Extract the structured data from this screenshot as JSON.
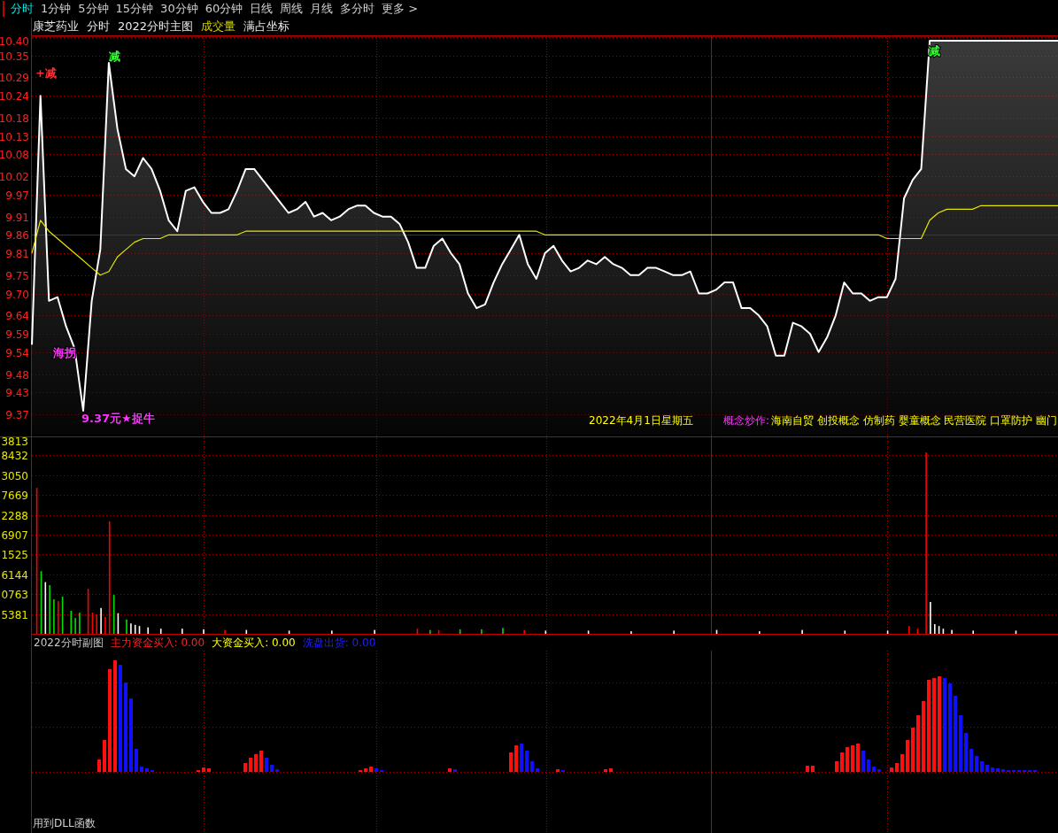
{
  "tabs": [
    {
      "label": "分时",
      "selected": true
    },
    {
      "label": "1分钟",
      "selected": false
    },
    {
      "label": "5分钟",
      "selected": false
    },
    {
      "label": "15分钟",
      "selected": false
    },
    {
      "label": "30分钟",
      "selected": false
    },
    {
      "label": "60分钟",
      "selected": false
    },
    {
      "label": "日线",
      "selected": false
    },
    {
      "label": "周线",
      "selected": false
    },
    {
      "label": "月线",
      "selected": false
    },
    {
      "label": "多分时",
      "selected": false
    },
    {
      "label": "更多 >",
      "selected": false
    }
  ],
  "header": {
    "items": [
      {
        "text": "康芝药业",
        "kind": "label"
      },
      {
        "text": "分时",
        "kind": "label"
      },
      {
        "text": "2022分时主图",
        "kind": "label"
      },
      {
        "text": "成交量",
        "kind": "study"
      },
      {
        "text": "满占坐标",
        "kind": "label"
      }
    ]
  },
  "price_chart": {
    "date": "2022年4月1日星期五",
    "concept_label": "概念炒作:",
    "concepts": "海南自贸 创投概念 仿制药 婴童概念 民营医院 口罩防护 幽门",
    "signals": [
      {
        "text": "+减",
        "color": "#ff3030"
      },
      {
        "text": "减",
        "color": "#33ff33"
      },
      {
        "text": "减",
        "color": "#33ff33"
      },
      {
        "text": "海拐",
        "color": "#ff33ff"
      },
      {
        "text": "9.37元★捉牛",
        "color": "#ff33ff"
      }
    ],
    "chart_data": {
      "type": "line",
      "ylim": [
        9.37,
        10.4
      ],
      "grid": true,
      "yticks": [
        {
          "value": 10.4,
          "label": "10.40"
        },
        {
          "value": 10.35,
          "label": "10.35"
        },
        {
          "value": 10.29,
          "label": "10.29"
        },
        {
          "value": 10.24,
          "label": "10.24"
        },
        {
          "value": 10.18,
          "label": "10.18"
        },
        {
          "value": 10.13,
          "label": "10.13"
        },
        {
          "value": 10.08,
          "label": "10.08"
        },
        {
          "value": 10.02,
          "label": "10.02"
        },
        {
          "value": 9.97,
          "label": "9.97"
        },
        {
          "value": 9.91,
          "label": "9.91"
        },
        {
          "value": 9.86,
          "label": "9.86"
        },
        {
          "value": 9.81,
          "label": "9.81"
        },
        {
          "value": 9.75,
          "label": "9.75"
        },
        {
          "value": 9.7,
          "label": "9.70"
        },
        {
          "value": 9.64,
          "label": "9.64"
        },
        {
          "value": 9.59,
          "label": "9.59"
        },
        {
          "value": 9.54,
          "label": "9.54"
        },
        {
          "value": 9.48,
          "label": "9.48"
        },
        {
          "value": 9.43,
          "label": "9.43"
        },
        {
          "value": 9.37,
          "label": "9.37"
        }
      ],
      "categories": [
        null,
        null,
        null,
        null,
        null,
        null,
        null,
        null,
        null,
        null,
        null,
        null,
        null,
        null,
        null,
        null,
        null,
        null,
        null,
        null,
        null,
        null,
        null,
        null,
        null,
        null,
        null,
        null,
        null,
        null,
        null,
        null,
        null,
        null,
        null,
        null,
        null,
        null,
        null,
        null,
        null,
        null,
        null,
        null,
        null,
        null,
        null,
        null,
        null,
        null,
        null,
        null,
        null,
        null,
        null,
        null,
        null,
        null,
        null,
        null,
        null,
        null,
        null,
        null,
        null,
        null,
        null,
        null,
        null,
        null,
        null,
        null,
        null,
        null,
        null,
        null,
        null,
        null,
        null,
        null,
        null,
        null,
        null,
        null,
        null,
        null,
        null,
        null,
        null,
        null,
        null,
        null,
        null,
        null,
        null,
        null,
        null,
        null,
        null,
        null,
        null,
        null,
        null,
        null,
        null,
        null,
        null,
        null,
        null,
        null,
        null,
        null,
        null,
        null,
        null,
        null,
        null,
        null,
        null,
        null,
        null
      ],
      "series": [
        {
          "color": "#ffffff",
          "values": [
            9.56,
            10.24,
            9.68,
            9.69,
            9.61,
            9.55,
            9.38,
            9.68,
            9.82,
            10.33,
            10.15,
            10.04,
            10.02,
            10.07,
            10.04,
            9.98,
            9.9,
            9.87,
            9.98,
            9.99,
            9.95,
            9.92,
            9.92,
            9.93,
            9.98,
            10.04,
            10.04,
            10.01,
            9.98,
            9.95,
            9.92,
            9.93,
            9.95,
            9.91,
            9.92,
            9.9,
            9.91,
            9.93,
            9.94,
            9.94,
            9.92,
            9.91,
            9.91,
            9.89,
            9.84,
            9.77,
            9.77,
            9.83,
            9.85,
            9.81,
            9.78,
            9.7,
            9.66,
            9.67,
            9.73,
            9.78,
            9.82,
            9.86,
            9.78,
            9.74,
            9.81,
            9.83,
            9.79,
            9.76,
            9.77,
            9.79,
            9.78,
            9.8,
            9.78,
            9.77,
            9.75,
            9.75,
            9.77,
            9.77,
            9.76,
            9.75,
            9.75,
            9.76,
            9.7,
            9.7,
            9.71,
            9.73,
            9.73,
            9.66,
            9.66,
            9.64,
            9.61,
            9.53,
            9.53,
            9.62,
            9.61,
            9.59,
            9.54,
            9.58,
            9.64,
            9.73,
            9.7,
            9.7,
            9.68,
            9.69,
            9.69,
            9.74,
            9.96,
            10.01,
            10.04,
            10.39,
            10.39,
            10.39,
            10.39,
            10.39,
            10.39,
            10.39,
            10.39,
            10.39,
            10.39,
            10.39,
            10.39,
            10.39,
            10.39,
            10.39,
            10.39
          ]
        },
        {
          "color": "#e6e600",
          "values": [
            9.81,
            9.9,
            9.87,
            9.85,
            9.83,
            9.81,
            9.79,
            9.77,
            9.75,
            9.76,
            9.8,
            9.82,
            9.84,
            9.85,
            9.85,
            9.85,
            9.86,
            9.86,
            9.86,
            9.86,
            9.86,
            9.86,
            9.86,
            9.86,
            9.86,
            9.87,
            9.87,
            9.87,
            9.87,
            9.87,
            9.87,
            9.87,
            9.87,
            9.87,
            9.87,
            9.87,
            9.87,
            9.87,
            9.87,
            9.87,
            9.87,
            9.87,
            9.87,
            9.87,
            9.87,
            9.87,
            9.87,
            9.87,
            9.87,
            9.87,
            9.87,
            9.87,
            9.87,
            9.87,
            9.87,
            9.87,
            9.87,
            9.87,
            9.87,
            9.87,
            9.86,
            9.86,
            9.86,
            9.86,
            9.86,
            9.86,
            9.86,
            9.86,
            9.86,
            9.86,
            9.86,
            9.86,
            9.86,
            9.86,
            9.86,
            9.86,
            9.86,
            9.86,
            9.86,
            9.86,
            9.86,
            9.86,
            9.86,
            9.86,
            9.86,
            9.86,
            9.86,
            9.86,
            9.86,
            9.86,
            9.86,
            9.86,
            9.86,
            9.86,
            9.86,
            9.86,
            9.86,
            9.86,
            9.86,
            9.86,
            9.85,
            9.85,
            9.85,
            9.85,
            9.85,
            9.9,
            9.92,
            9.93,
            9.93,
            9.93,
            9.93,
            9.94,
            9.94,
            9.94,
            9.94,
            9.94,
            9.94,
            9.94,
            9.94,
            9.94,
            9.94
          ]
        }
      ]
    }
  },
  "volume_chart": {
    "axis_labels": [
      "3813",
      "8432",
      "3050",
      "7669",
      "2288",
      "6907",
      "1525",
      "6144",
      "0763",
      "5381"
    ]
  },
  "sub_chart": {
    "title": "2022分时副图",
    "indicators": [
      {
        "text": "主力资金买入: 0.00",
        "color": "#ff2020"
      },
      {
        "text": "大资金买入: 0.00",
        "color": "#ffff00"
      },
      {
        "text": "洗盘出货: 0.00",
        "color": "#2020ff"
      }
    ],
    "note": "用到DLL函数"
  }
}
